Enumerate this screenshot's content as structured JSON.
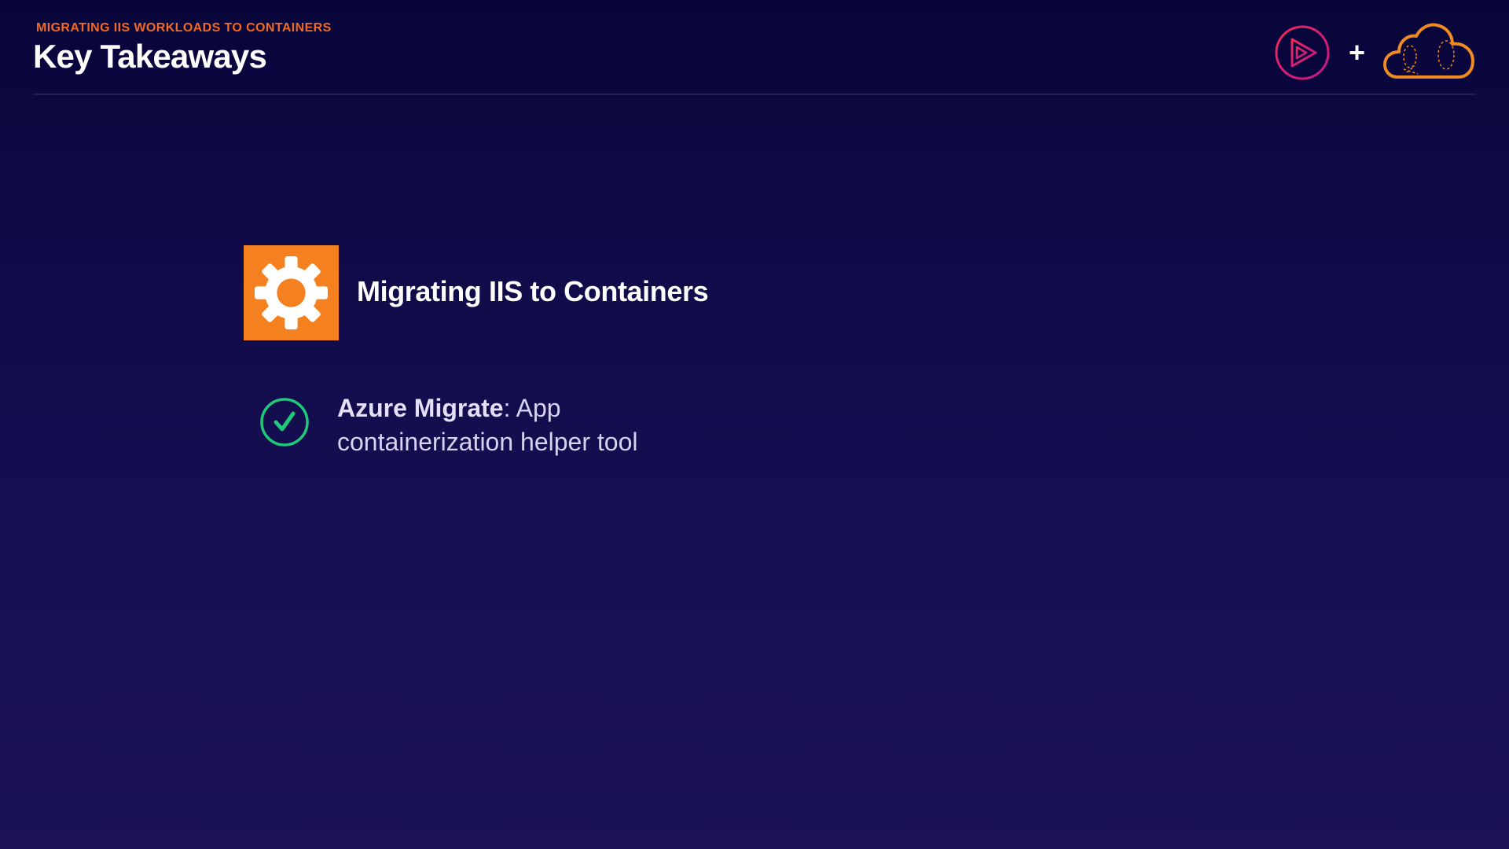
{
  "header": {
    "eyebrow": "MIGRATING IIS WORKLOADS TO CONTAINERS",
    "title": "Key Takeaways",
    "plus": "+"
  },
  "logos": {
    "left": "pluralsight-play-icon",
    "right": "cloud-icon"
  },
  "section": {
    "icon": "gear-icon",
    "title": "Migrating IIS to Containers"
  },
  "takeaways": [
    {
      "icon": "check-circle-icon",
      "bold": "Azure Migrate",
      "text": ": App containerization helper tool"
    }
  ],
  "colors": {
    "accent_orange": "#f58020",
    "eyebrow": "#f06a26",
    "check_green": "#1fc97a",
    "logo_pink": "#e0245e"
  }
}
